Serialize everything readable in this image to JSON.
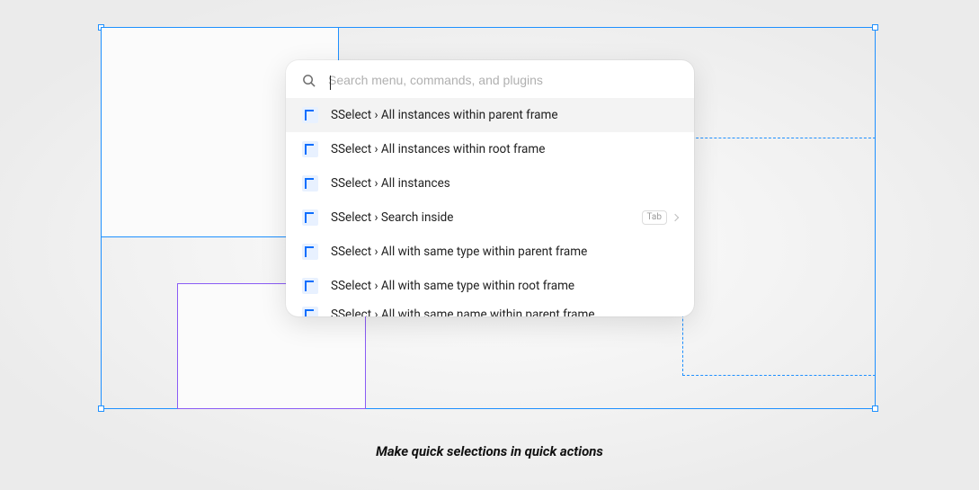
{
  "search": {
    "placeholder": "Search menu, commands, and plugins",
    "value": ""
  },
  "palette_items": [
    {
      "label": "SSelect › All instances within parent frame",
      "highlighted": true
    },
    {
      "label": "SSelect › All instances within root frame"
    },
    {
      "label": "SSelect › All instances"
    },
    {
      "label": "SSelect › Search inside",
      "has_tab_hint": true,
      "tab_hint": "Tab"
    },
    {
      "label": "SSelect › All with same type within parent frame"
    },
    {
      "label": "SSelect › All with same type within root frame"
    },
    {
      "label": "SSelect › All with same name within parent frame",
      "cut": true
    }
  ],
  "caption": "Make quick selections in quick actions",
  "colors": {
    "selection": "#1e90ff",
    "purple": "#8a5cf5"
  }
}
